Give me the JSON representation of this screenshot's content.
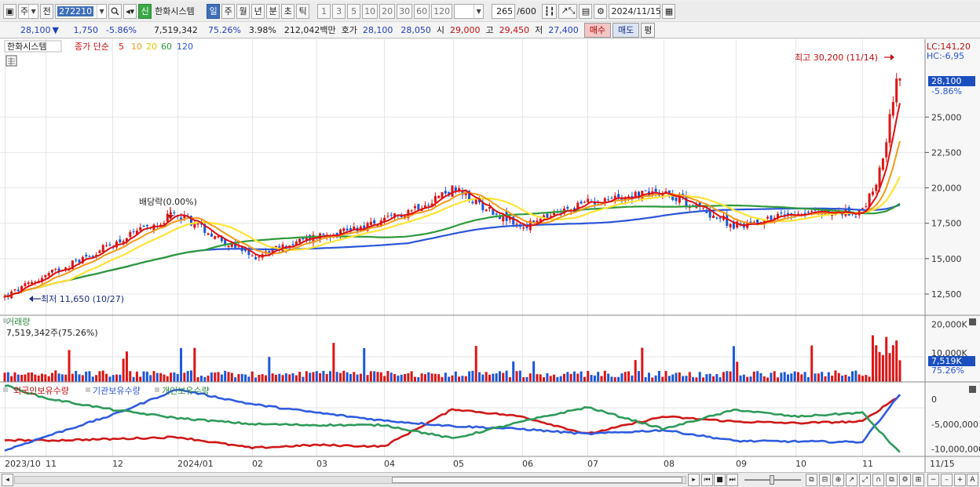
{
  "toolbar": {
    "market": "주",
    "prev": "전",
    "code": "272210",
    "name_badge": "신",
    "stock_name": "한화시스템",
    "periods": [
      "일",
      "주",
      "월",
      "년",
      "분",
      "초",
      "틱"
    ],
    "minutes": [
      "1",
      "3",
      "5",
      "10",
      "20",
      "30",
      "60",
      "120"
    ],
    "count": "265",
    "count_max": "/600",
    "date": "2024/11/15"
  },
  "quote": {
    "price": "28,100",
    "change": "1,750",
    "pct": "-5.86%",
    "volume": "7,519,342",
    "turnover": "75.26%",
    "ratio": "3.98%",
    "amount": "212,042백만",
    "ask_label": "호가",
    "ask": "28,100",
    "bid": "28,050",
    "open_label": "시",
    "open": "29,000",
    "high_label": "고",
    "high": "29,450",
    "low_label": "저",
    "low": "27,400",
    "buy": "매수",
    "sell": "매도",
    "eval": "평"
  },
  "price_panel": {
    "legend_name": "한화시스템",
    "legend_ma": "종가 단순",
    "ma_periods": [
      "5",
      "10",
      "20",
      "60",
      "120"
    ],
    "lc": "LC:141,20",
    "hc": "HC:-6,95",
    "high_note": "최고 30,200 (11/14)",
    "low_note": "최저 11,650 (10/27)",
    "dividend_note": "배당락(0.00%)",
    "price_tag": "28,100",
    "pct_tag": "-5.86%",
    "y_labels": [
      "25,000",
      "22,500",
      "20,000",
      "17,500",
      "15,000",
      "12,500"
    ]
  },
  "volume_panel": {
    "title": "거래량",
    "value": "7,519,342주(75.26%)",
    "y_labels": [
      "20,000K",
      "10,000K"
    ],
    "tag": "7,519K",
    "pct_tag": "75.26%"
  },
  "holdings_panel": {
    "labels": [
      "외국인보유수량",
      "기관보유수량",
      "개인보유수량"
    ],
    "y_labels": [
      "0",
      "-5,000,000",
      "-10,000,000"
    ]
  },
  "x_axis": [
    "2023/10",
    "11",
    "12",
    "2024/01",
    "02",
    "03",
    "04",
    "05",
    "06",
    "07",
    "08",
    "09",
    "10",
    "11",
    "11/15"
  ],
  "colors": {
    "ma5": "#e01010",
    "ma10": "#f29a1a",
    "ma20": "#ffe433",
    "ma60": "#2f9a3a",
    "ma120": "#2a56d8",
    "up": "#dd1515",
    "down": "#1a58d8"
  },
  "chart_data": {
    "type": "line",
    "x": [
      "2023/10/11",
      "11/01",
      "12/01",
      "2024/01/02",
      "02/01",
      "03/04",
      "04/01",
      "05/02",
      "06/03",
      "07/01",
      "08/01",
      "09/02",
      "10/02",
      "11/01",
      "11/15"
    ],
    "series": [
      {
        "name": "종가",
        "values": [
          12300,
          13800,
          16000,
          18200,
          15100,
          16600,
          17600,
          19900,
          17200,
          19000,
          19800,
          17300,
          18300,
          18200,
          28100
        ]
      },
      {
        "name": "외국인보유수량",
        "values": [
          -8200000,
          -8300000,
          -8000000,
          -7600000,
          -9800000,
          -9200000,
          -9500000,
          -2000000,
          -3500000,
          -7000000,
          -3500000,
          -4500000,
          -4800000,
          -4500000,
          800000
        ]
      },
      {
        "name": "기관보유수량",
        "values": [
          -10300000,
          -7500000,
          -3200000,
          2000000,
          -1000000,
          -2700000,
          -4300000,
          -5400000,
          -6000000,
          -7000000,
          -6200000,
          -8400000,
          -8500000,
          -8600000,
          1000000
        ]
      },
      {
        "name": "개인보유수량",
        "values": [
          2800000,
          200000,
          -2100000,
          -3800000,
          -5000000,
          -5200000,
          -5200000,
          -7900000,
          -4500000,
          -1600000,
          -6000000,
          -2100000,
          -3500000,
          -2700000,
          -10800000
        ]
      }
    ],
    "ylim": [
      11000,
      30500
    ],
    "volume_ylim": [
      0,
      22000000
    ]
  }
}
